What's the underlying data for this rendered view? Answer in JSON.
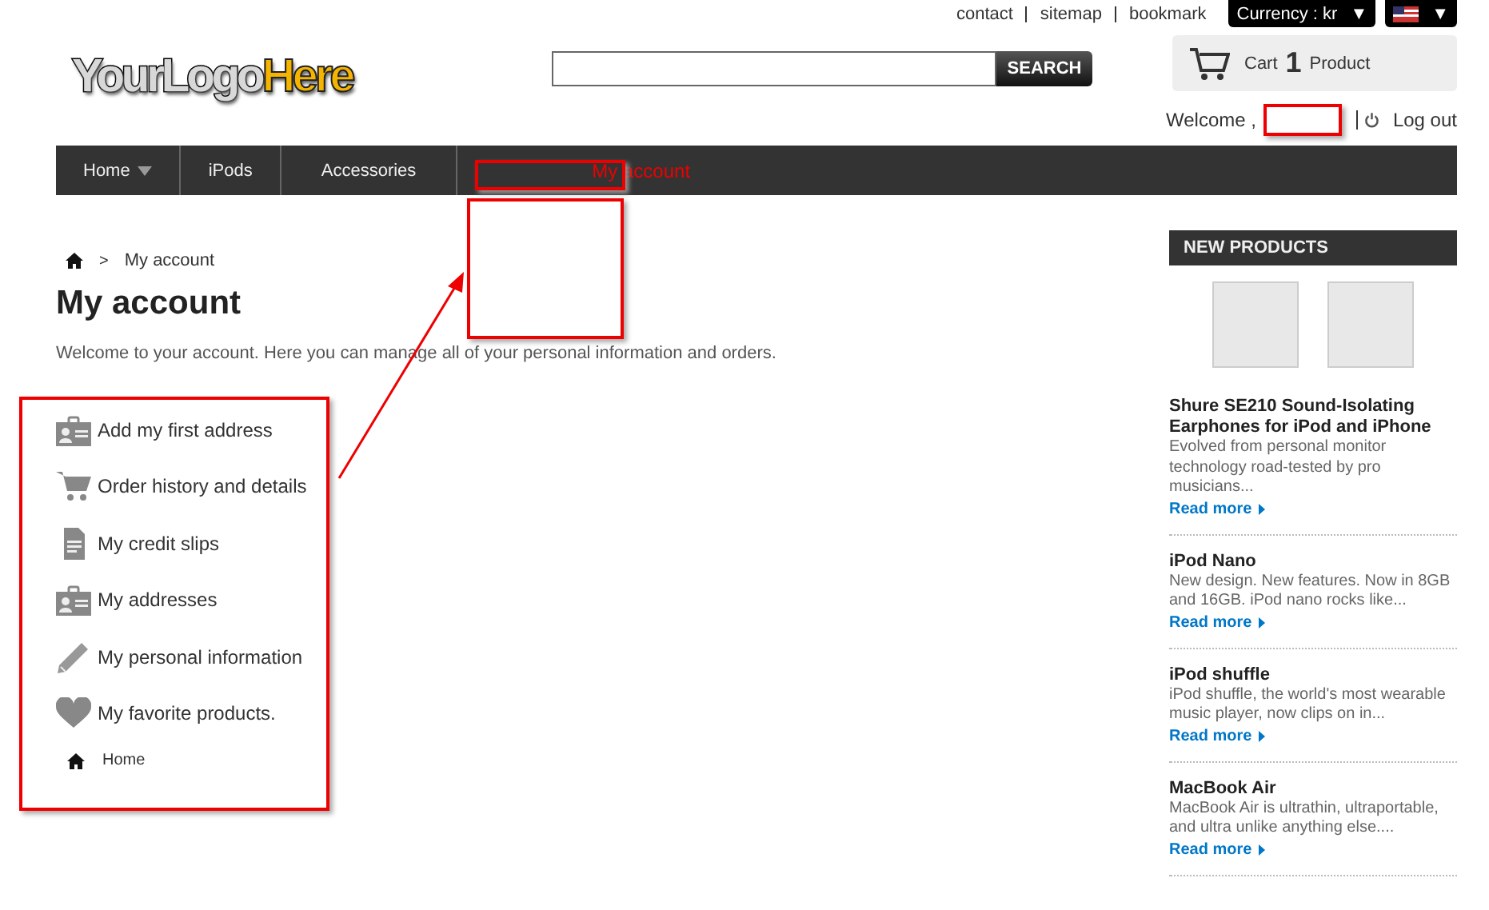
{
  "top_links": [
    "contact",
    "sitemap",
    "bookmark"
  ],
  "currency": {
    "label": "Currency : kr",
    "caret": "▼"
  },
  "language": {
    "caret": "▼"
  },
  "logo": {
    "part_1": "YourLogo",
    "part_2": "Here"
  },
  "search": {
    "button": "SEARCH"
  },
  "cart": {
    "label": "Cart",
    "count": "1",
    "unit": "Product"
  },
  "welcome": {
    "label": "Welcome ,",
    "logout": "Log out"
  },
  "nav": [
    {
      "label": "Home",
      "has_caret": true,
      "highlighted": false
    },
    {
      "label": "iPods",
      "has_caret": false,
      "highlighted": false
    },
    {
      "label": "Accessories",
      "has_caret": false,
      "highlighted": false
    },
    {
      "label": "My account",
      "has_caret": false,
      "highlighted": true
    }
  ],
  "breadcrumb": {
    "separator": ">",
    "current": "My account"
  },
  "page_title": "My account",
  "intro": "Welcome to your account. Here you can manage all of your personal information and orders.",
  "account_links": [
    {
      "kind": "address",
      "label": "Add my first address"
    },
    {
      "kind": "cart",
      "label": "Order history and details"
    },
    {
      "kind": "document",
      "label": "My credit slips"
    },
    {
      "kind": "address",
      "label": "My addresses"
    },
    {
      "kind": "pencil",
      "label": "My personal information"
    },
    {
      "kind": "heart",
      "label": "My favorite products."
    }
  ],
  "home_link": "Home",
  "new_products": {
    "title": "NEW PRODUCTS",
    "items": [
      {
        "title": "Shure SE210 Sound-Isolating Earphones for iPod and iPhone",
        "description": "Evolved from personal monitor technology road-tested by pro musicians...",
        "link": "Read more"
      },
      {
        "title": "iPod Nano",
        "description": "New design. New features. Now in 8GB and 16GB. iPod nano rocks like...",
        "link": "Read more"
      },
      {
        "title": "iPod shuffle",
        "description": "iPod shuffle, the world's most wearable music player, now clips on in...",
        "link": "Read more"
      },
      {
        "title": "MacBook Air",
        "description": "MacBook Air is ultrathin, ultraportable, and ultra unlike anything else....",
        "link": "Read more"
      }
    ]
  }
}
